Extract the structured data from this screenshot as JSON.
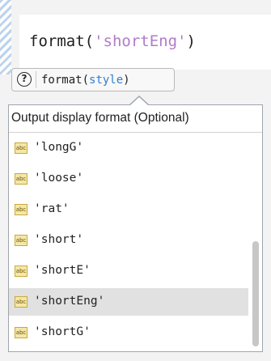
{
  "editor": {
    "code": {
      "func": "format(",
      "arg": "'shortEng'",
      "close": ")"
    }
  },
  "signature": {
    "help_icon": "question-circle-icon",
    "help_glyph": "?",
    "func": "format(",
    "param": "style",
    "close": ")"
  },
  "completion": {
    "header": "Output display format (Optional)",
    "item_icon": "string-abc-icon",
    "item_icon_text": "abc",
    "items": [
      {
        "label": "'longG'"
      },
      {
        "label": "'loose'"
      },
      {
        "label": "'rat'"
      },
      {
        "label": "'short'"
      },
      {
        "label": "'shortE'"
      },
      {
        "label": "'shortEng'"
      },
      {
        "label": "'shortG'"
      }
    ],
    "selected_index": 5
  },
  "colors": {
    "string_literal": "#b07cc7",
    "parameter": "#2f7fd1",
    "selection": "#e1e1e1"
  }
}
